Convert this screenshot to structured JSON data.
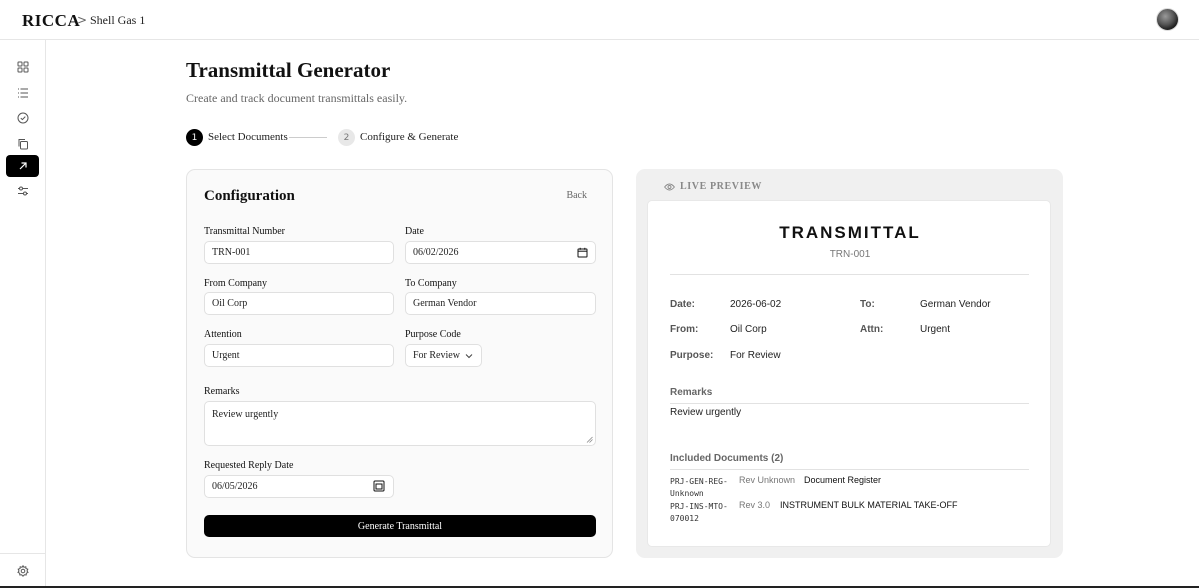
{
  "header": {
    "brand": "RICCA",
    "breadcrumb_sep": ">",
    "breadcrumb": "Shell Gas 1"
  },
  "sidebar": {
    "items": [
      {
        "icon": "grid-icon"
      },
      {
        "icon": "list-icon"
      },
      {
        "icon": "check-circle-icon"
      },
      {
        "icon": "copy-icon"
      },
      {
        "icon": "arrow-up-right-icon",
        "active": true
      },
      {
        "icon": "sliders-icon"
      }
    ],
    "bottom": {
      "icon": "gear-icon"
    }
  },
  "page": {
    "title": "Transmittal Generator",
    "subtitle": "Create and track document transmittals easily."
  },
  "stepper": {
    "steps": [
      {
        "number": "1",
        "label": "Select Documents",
        "active": true
      },
      {
        "number": "2",
        "label": "Configure & Generate",
        "active": false
      }
    ]
  },
  "config": {
    "title": "Configuration",
    "back_label": "Back",
    "transmittal_number": {
      "label": "Transmittal Number",
      "value": "TRN-001"
    },
    "date": {
      "label": "Date",
      "value": "06/02/2026"
    },
    "from_company": {
      "label": "From Company",
      "value": "Oil Corp"
    },
    "to_company": {
      "label": "To Company",
      "value": "German Vendor"
    },
    "attention": {
      "label": "Attention",
      "value": "Urgent"
    },
    "purpose_code": {
      "label": "Purpose Code",
      "value": "For Review"
    },
    "remarks": {
      "label": "Remarks",
      "value": "Review urgently"
    },
    "reply_date": {
      "label": "Requested Reply Date",
      "value": "06/05/2026"
    },
    "generate_label": "Generate Transmittal"
  },
  "preview": {
    "live_label": "LIVE PREVIEW",
    "title": "TRANSMITTAL",
    "number": "TRN-001",
    "date_key": "Date:",
    "date_val": "2026-06-02",
    "to_key": "To:",
    "to_val": "German Vendor",
    "from_key": "From:",
    "from_val": "Oil Corp",
    "attn_key": "Attn:",
    "attn_val": "Urgent",
    "purpose_key": "Purpose:",
    "purpose_val": "For Review",
    "remarks_heading": "Remarks",
    "remarks_text": "Review urgently",
    "docs_heading": "Included Documents (2)",
    "documents": [
      {
        "code": "PRJ-GEN-REG-Unknown",
        "rev": "Rev Unknown",
        "title": "Document Register"
      },
      {
        "code": "PRJ-INS-MTO-070012",
        "rev": "Rev 3.0",
        "title": "INSTRUMENT BULK MATERIAL TAKE-OFF"
      }
    ]
  }
}
